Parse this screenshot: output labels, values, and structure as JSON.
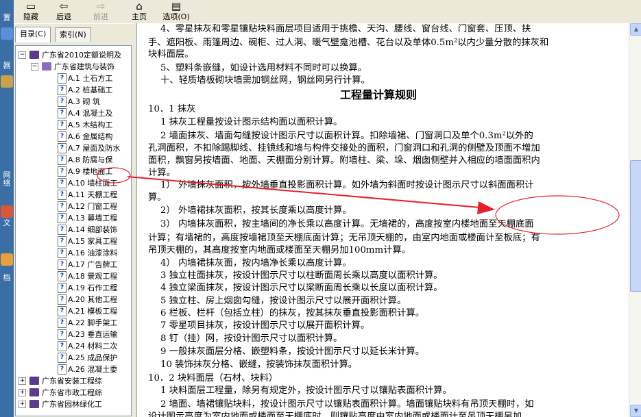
{
  "desktop": {
    "chars": [
      "置",
      "器",
      "网",
      "络",
      "文",
      "档"
    ]
  },
  "toolbar": {
    "buttons": [
      {
        "label": "隐藏",
        "icon": "hide-icon"
      },
      {
        "label": "后退",
        "icon": "back-arrow-icon"
      },
      {
        "label": "前进",
        "icon": "forward-arrow-icon"
      },
      {
        "label": "主页",
        "icon": "home-icon"
      },
      {
        "label": "选项(O)",
        "icon": "options-icon"
      }
    ]
  },
  "nav": {
    "tabs": [
      {
        "label": "目录(C)"
      },
      {
        "label": "索引(N)"
      }
    ],
    "tree": [
      {
        "text": "广东省2010定额说明及",
        "type": "book",
        "expander": "−"
      },
      {
        "text": "广东省建筑与装饰",
        "type": "bookopen",
        "expander": "−"
      },
      {
        "text": "A.1   土石方工",
        "type": "page"
      },
      {
        "text": "A.2   桩基础工",
        "type": "page"
      },
      {
        "text": "A.3   砌  筑",
        "type": "page"
      },
      {
        "text": "A.4   混凝土及",
        "type": "page"
      },
      {
        "text": "A.5   木结构工",
        "type": "page"
      },
      {
        "text": "A.6   金属结构",
        "type": "page"
      },
      {
        "text": "A.7  屋面及防水",
        "type": "page"
      },
      {
        "text": "A.8   防腐与保",
        "type": "page"
      },
      {
        "text": "A.9   楼地面工",
        "type": "page"
      },
      {
        "text": "A.10   墙柱面工",
        "type": "page",
        "selected": true
      },
      {
        "text": "A.11   天棚工程",
        "type": "page"
      },
      {
        "text": "A.12   门窗工程",
        "type": "page"
      },
      {
        "text": "A.13   幕墙工程",
        "type": "page"
      },
      {
        "text": "A.14   细部装饰",
        "type": "page"
      },
      {
        "text": "A.15   家具工程",
        "type": "page"
      },
      {
        "text": "A.16   油漆涂料",
        "type": "page"
      },
      {
        "text": "A.17   广告牌工",
        "type": "page"
      },
      {
        "text": "A.18  景观工程",
        "type": "page"
      },
      {
        "text": "A.19  石作工程",
        "type": "page"
      },
      {
        "text": "A.20   其他工程",
        "type": "page"
      },
      {
        "text": "A.21   模板工程",
        "type": "page"
      },
      {
        "text": "A.22   脚手架工",
        "type": "page"
      },
      {
        "text": "A.23   垂直运输",
        "type": "page"
      },
      {
        "text": "A.24   材料二次",
        "type": "page"
      },
      {
        "text": "A.25   成品保护",
        "type": "page"
      },
      {
        "text": "A.26   混凝土委",
        "type": "page"
      },
      {
        "text": "广东省安装工程综",
        "type": "book",
        "expander": "+"
      },
      {
        "text": "广东省市政工程综",
        "type": "book",
        "expander": "+"
      },
      {
        "text": "广东省园林绿化工",
        "type": "book",
        "expander": "+"
      }
    ]
  },
  "doc": {
    "lines": [
      "4、零星抹灰和零星镶贴块料面层项目适用于挑檐、天沟、腰线、窗台线、门窗套、压顶、扶",
      "手、遮阳板、雨篷周边、碗柜、过人洞、暖气壁龛池槽、花台以及单体0.5m²以内少量分散的抹灰和",
      "块料面层。",
      "5、塑料条嵌缝，如设计选用材料不同时可以换算。",
      "十、轻质墙板砌块墙需加钢丝网，钢丝网另行计算。",
      "工程量计算规则",
      "10．1  抹灰",
      "1  抹灰工程量按设计图示结构面以面积计算。",
      "2  墙面抹灰、墙面勾缝按设计图示尺寸以面积计算。扣除墙裙、门窗洞口及单个0.3m²以外的",
      "孔洞面积，不扣除踢脚线、挂镜线和墙与构件交接处的面积，门窗洞口和孔洞的侧壁及顶面不增加",
      "面积，飘窗另按墙面、地面、天棚面分别计算。附墙柱、梁、垛、烟囱侧壁并入相应的墙面面积内",
      "计算。",
      "1）  外墙抹灰面积，按外墙垂直投影面积计算。如外墙为斜面时按设计图示尺寸以斜面面积计",
      "算。",
      "2）  外墙裙抹灰面积，按其长度乘以高度计算。",
      "3）  内墙抹灰面积，按主墙间的净长乘以高度计算。无墙裙的，高度按室内楼地面至天棚底面",
      "计算；有墙裙的，高度按墙裙顶至天棚底面计算；无吊顶天棚的，由室内地面或楼面计至板底；有",
      "吊顶天棚的，其高度按室内地面或楼面至天棚另加100mm计算。",
      "4）  内墙裙抹灰面，按内墙净长乘以高度计算。",
      "3  独立柱面抹灰，按设计图示尺寸以柱断面周长乘以高度以面积计算。",
      "4  独立梁面抹灰，按设计图示尺寸以梁断面周长乘以长度以面积计算。",
      "5  独立柱、房上烟囱勾缝，按设计图示尺寸以展开面积计算。",
      "6  栏板、栏杆（包括立柱）的抹灰，按其抹灰垂直投影面积计算。",
      "7  零星项目抹灰，按设计图示尺寸以展开面积计算。",
      "8  钉（挂）网，按设计图示尺寸以面积计算。",
      "9  一般抹灰面层分格、嵌塑料条，按设计图示尺寸以延长米计算。",
      "10  装饰抹灰分格、嵌缝，按装饰抹灰面积计算。",
      "10．2  块料面层（石材、块料）",
      "1  块料面层工程量，除另有规定外，按设计图示尺寸以镶贴表面积计算。",
      "2  墙面、墙裙镶贴块料，按设计图示尺寸以镶贴表面积计算。墙面镶贴块料有吊顶天棚时，如",
      "设计图示高度为室内地面或楼面至天棚底时，则镶贴高度由室内地面或楼面计至吊顶天棚另加"
    ]
  },
  "annotation": {
    "color": "#e8202a"
  }
}
